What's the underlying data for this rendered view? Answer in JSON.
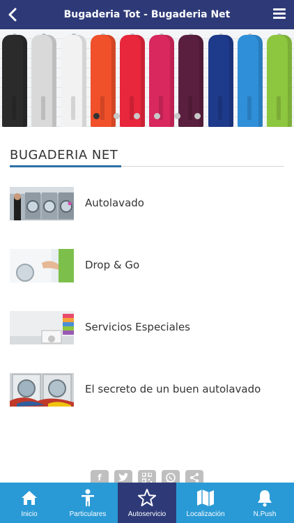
{
  "header": {
    "title": "Bugaderia Tot - Bugaderia Net",
    "back_icon": "chevron-left-icon",
    "menu_icon": "hamburger-menu-icon"
  },
  "banner": {
    "robe_colors": [
      "#2b2b2b",
      "#d9d9d9",
      "#f2f2f2",
      "#f0502a",
      "#e8263c",
      "#d8285e",
      "#5a1f3e",
      "#1e3a8a",
      "#2f8fd8",
      "#8dc63f"
    ],
    "slide_count": 6,
    "active_slide": 0
  },
  "section": {
    "title": "BUGADERIA NET"
  },
  "items": [
    {
      "label": "Autolavado"
    },
    {
      "label": "Drop & Go"
    },
    {
      "label": "Servicios Especiales"
    },
    {
      "label": "El secreto de un buen autolavado"
    }
  ],
  "share": {
    "facebook": "f",
    "twitter": "twitter-icon",
    "qr": "qr-code-icon",
    "whatsapp": "whatsapp-icon",
    "share": "share-icon"
  },
  "tabs": [
    {
      "label": "Inicio",
      "icon": "home-icon"
    },
    {
      "label": "Particulares",
      "icon": "person-icon"
    },
    {
      "label": "Autoservicio",
      "icon": "star-icon",
      "active": true
    },
    {
      "label": "Localización",
      "icon": "map-icon"
    },
    {
      "label": "N.Push",
      "icon": "bell-icon"
    }
  ],
  "colors": {
    "header_bg": "#2e3a78",
    "tabbar_bg": "#2a9ad6",
    "tab_active_bg": "#2e3a78",
    "accent": "#2d6fa8"
  }
}
